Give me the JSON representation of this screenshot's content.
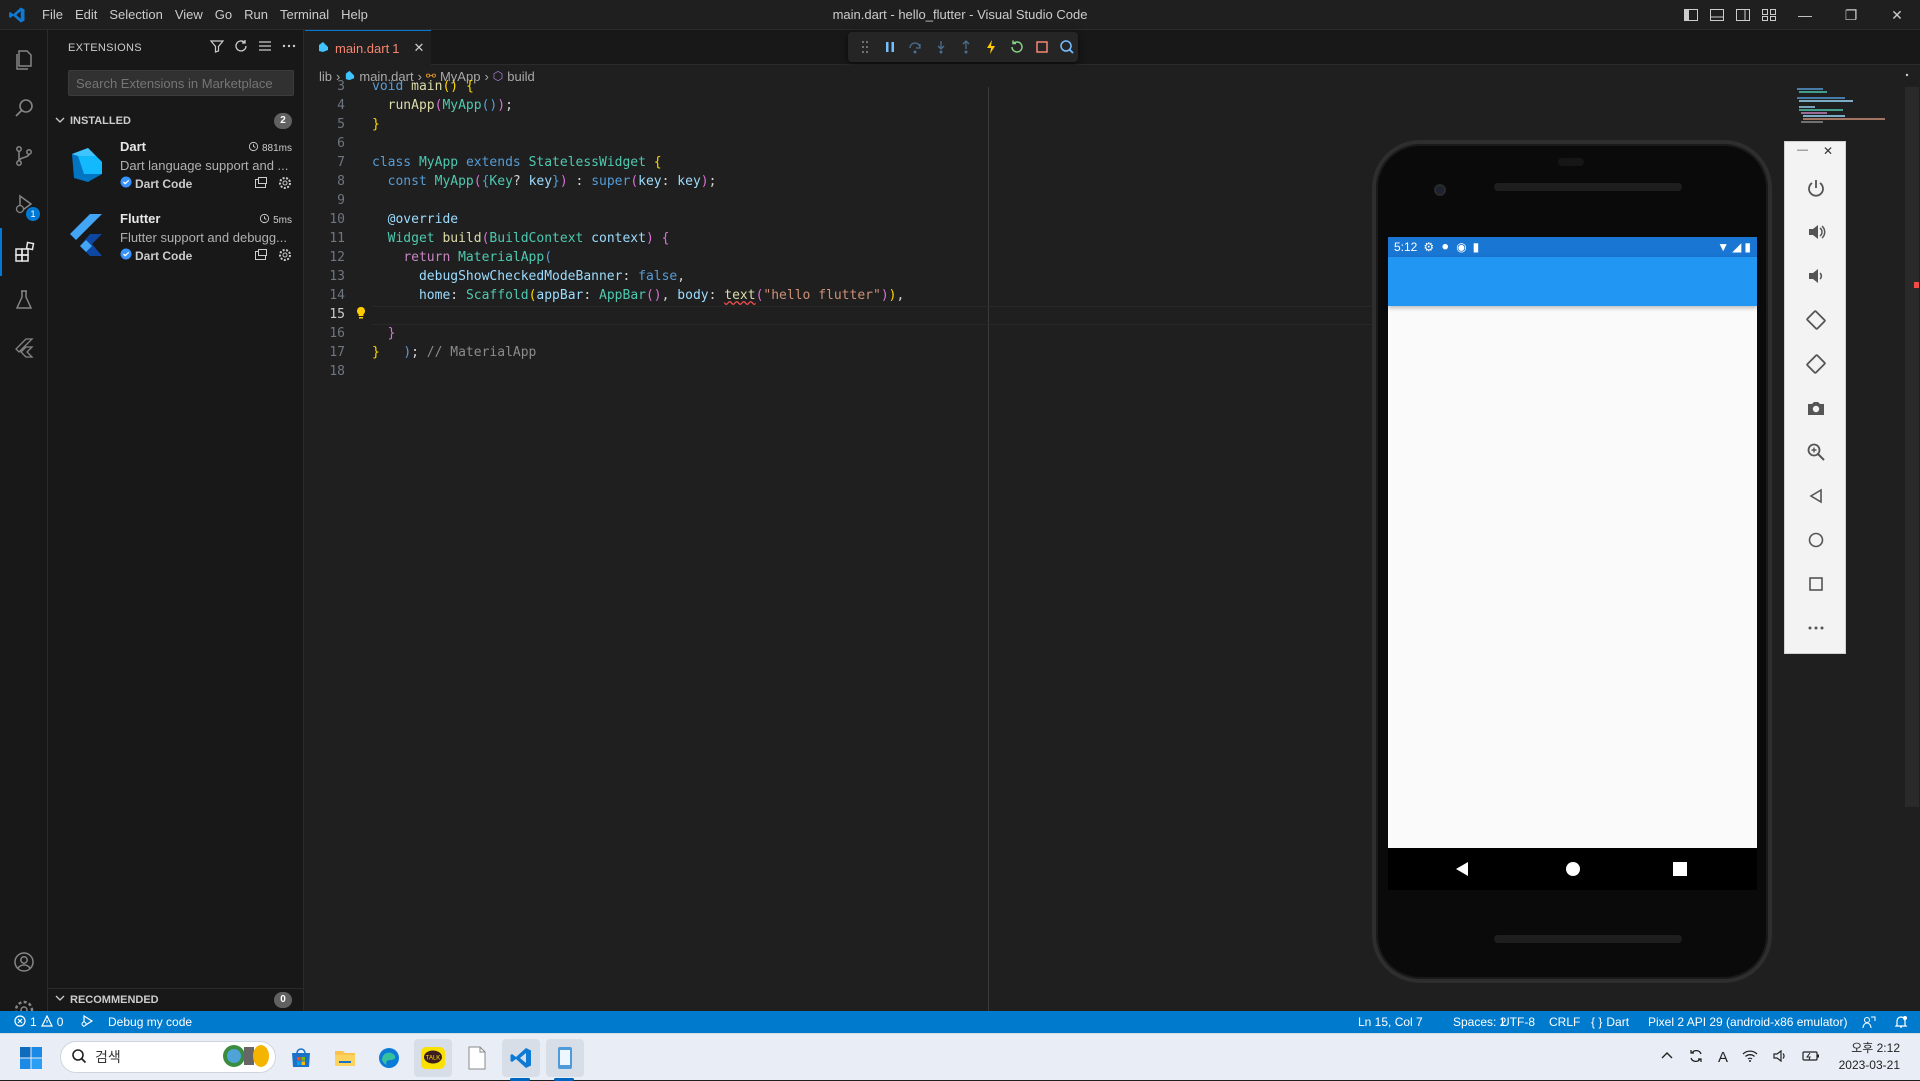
{
  "window": {
    "title": "main.dart - hello_flutter - Visual Studio Code",
    "menu": [
      "File",
      "Edit",
      "Selection",
      "View",
      "Go",
      "Run",
      "Terminal",
      "Help"
    ]
  },
  "activity_bar": {
    "items": [
      "explorer-icon",
      "search-icon",
      "source-control-icon",
      "run-debug-icon",
      "extensions-icon",
      "testing-icon",
      "flutter-icon"
    ],
    "debug_badge": "1",
    "bottom": [
      "accounts-icon",
      "manage-gear-icon"
    ]
  },
  "sidebar": {
    "title": "EXTENSIONS",
    "search_placeholder": "Search Extensions in Marketplace",
    "installed": {
      "label": "INSTALLED",
      "count": "2",
      "items": [
        {
          "name": "Dart",
          "description": "Dart language support and ...",
          "publisher": "Dart Code",
          "time": "881ms"
        },
        {
          "name": "Flutter",
          "description": "Flutter support and debugg...",
          "publisher": "Dart Code",
          "time": "5ms"
        }
      ]
    },
    "recommended": {
      "label": "RECOMMENDED",
      "count": "0"
    }
  },
  "tabs": [
    {
      "label": "main.dart",
      "problems": "1"
    }
  ],
  "breadcrumb": [
    "lib",
    "main.dart",
    "MyApp",
    "build"
  ],
  "editor": {
    "current_line": 15,
    "lines": [
      {
        "n": "3",
        "text": "void main() {"
      },
      {
        "n": "4",
        "text": "  runApp(MyApp());"
      },
      {
        "n": "5",
        "text": "}"
      },
      {
        "n": "6",
        "text": ""
      },
      {
        "n": "7",
        "text": "class MyApp extends StatelessWidget {"
      },
      {
        "n": "8",
        "text": "  const MyApp({Key? key}) : super(key: key);"
      },
      {
        "n": "9",
        "text": ""
      },
      {
        "n": "10",
        "text": "  @override"
      },
      {
        "n": "11",
        "text": "  Widget build(BuildContext context) {"
      },
      {
        "n": "12",
        "text": "    return MaterialApp("
      },
      {
        "n": "13",
        "text": "      debugShowCheckedModeBanner: false,"
      },
      {
        "n": "14",
        "text": "      home: Scaffold(appBar: AppBar(), body: text(\"hello flutter\")),"
      },
      {
        "n": "15",
        "text": "    ); // MaterialApp"
      },
      {
        "n": "16",
        "text": "  }"
      },
      {
        "n": "17",
        "text": "}"
      },
      {
        "n": "18",
        "text": ""
      }
    ]
  },
  "emulator": {
    "status_time": "5:12",
    "side_buttons": [
      "power-icon",
      "volume-up-icon",
      "volume-down-icon",
      "rotate-left-icon",
      "rotate-right-icon",
      "camera-icon",
      "zoom-icon",
      "back-icon",
      "home-icon",
      "overview-icon",
      "more-icon"
    ]
  },
  "statusbar": {
    "errors": "1",
    "warnings": "0",
    "debug_label": "Debug my code",
    "position": "Ln 15, Col 7",
    "spaces": "Spaces: 2",
    "encoding": "UTF-8",
    "eol": "CRLF",
    "language": "Dart",
    "device": "Pixel 2 API 29 (android-x86 emulator)"
  },
  "taskbar": {
    "search_placeholder": "검색",
    "clock_time": "오후 2:12",
    "clock_date": "2023-03-21"
  },
  "colors": {
    "accent": "#007acc",
    "statusbar": "#007acc",
    "appbar": "#2196f3",
    "phone_status": "#1976d2"
  }
}
